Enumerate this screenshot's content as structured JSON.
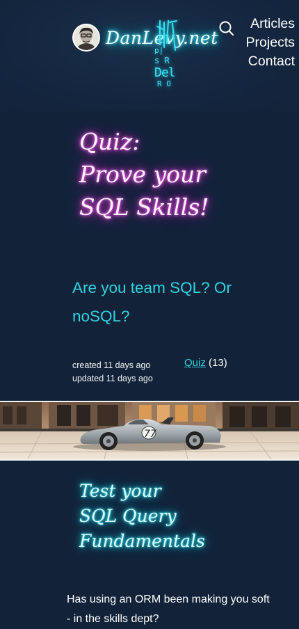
{
  "header": {
    "brand": "DanLevy.net",
    "nav": [
      "Articles",
      "Projects",
      "Contact"
    ]
  },
  "hero": {
    "title_lines": [
      "Quiz:",
      "Prove your",
      "SQL Skills!"
    ],
    "subtitle": "Are you team SQL? Or noSQL?"
  },
  "meta": {
    "created": "created 11 days ago",
    "updated": "updated 11 days ago",
    "tag_label": "Quiz",
    "tag_count": "(13)"
  },
  "article": {
    "section_heading_lines": [
      "Test your",
      "SQL Query",
      "Fundamentals"
    ],
    "intro": "Has using an ORM been making you soft - in the skills dept?"
  },
  "icons": {
    "search": "search-icon",
    "avatar": "avatar",
    "hero_image": "race-car-photo"
  },
  "colors": {
    "background": "#122339",
    "accent_cyan": "#2fd3e0",
    "neon_pink": "#ec3dd8"
  }
}
